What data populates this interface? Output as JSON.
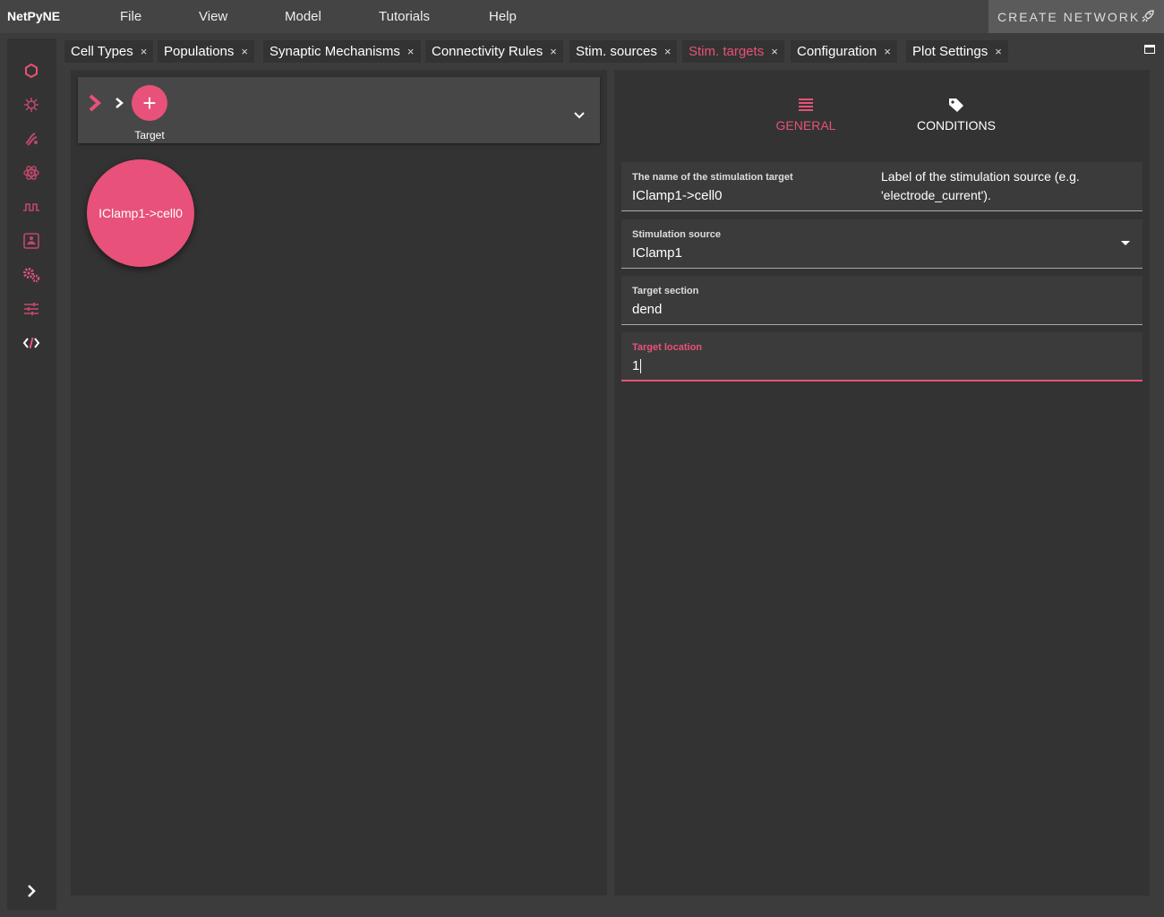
{
  "app": {
    "brand": "NetPyNE"
  },
  "menu": [
    "File",
    "View",
    "Model",
    "Tutorials",
    "Help"
  ],
  "create_button": "CREATE NETWORK",
  "tabs": [
    {
      "label": "Cell Types"
    },
    {
      "label": "Populations"
    },
    {
      "label": "Synaptic Mechanisms"
    },
    {
      "label": "Connectivity Rules"
    },
    {
      "label": "Stim. sources"
    },
    {
      "label": "Stim. targets",
      "active": true
    },
    {
      "label": "Configuration"
    },
    {
      "label": "Plot Settings"
    }
  ],
  "tab_close": "×",
  "breadcrumb": {
    "add_symbol": "+",
    "add_label": "Target"
  },
  "target_card": "IClamp1->cell0",
  "right_tabs": {
    "general": "GENERAL",
    "conditions": "CONDITIONS"
  },
  "fields": {
    "name": {
      "label": "The name of the stimulation target",
      "value": "IClamp1->cell0"
    },
    "source": {
      "label": "Stimulation source",
      "value": "IClamp1"
    },
    "section": {
      "label": "Target section",
      "value": "dend"
    },
    "location": {
      "label": "Target location",
      "value": "1"
    }
  },
  "tooltip": "Label of the stimulation source (e.g. 'electrode_current').",
  "colors": {
    "accent": "#e8517a",
    "panel": "#333333",
    "topbar": "#444444"
  },
  "sidebar_icons": [
    "hexagon-icon",
    "cell-icon",
    "synapse-icon",
    "atom-icon",
    "pulse-icon",
    "stim-target-icon",
    "gears-icon",
    "sliders-icon",
    "code-icon"
  ]
}
